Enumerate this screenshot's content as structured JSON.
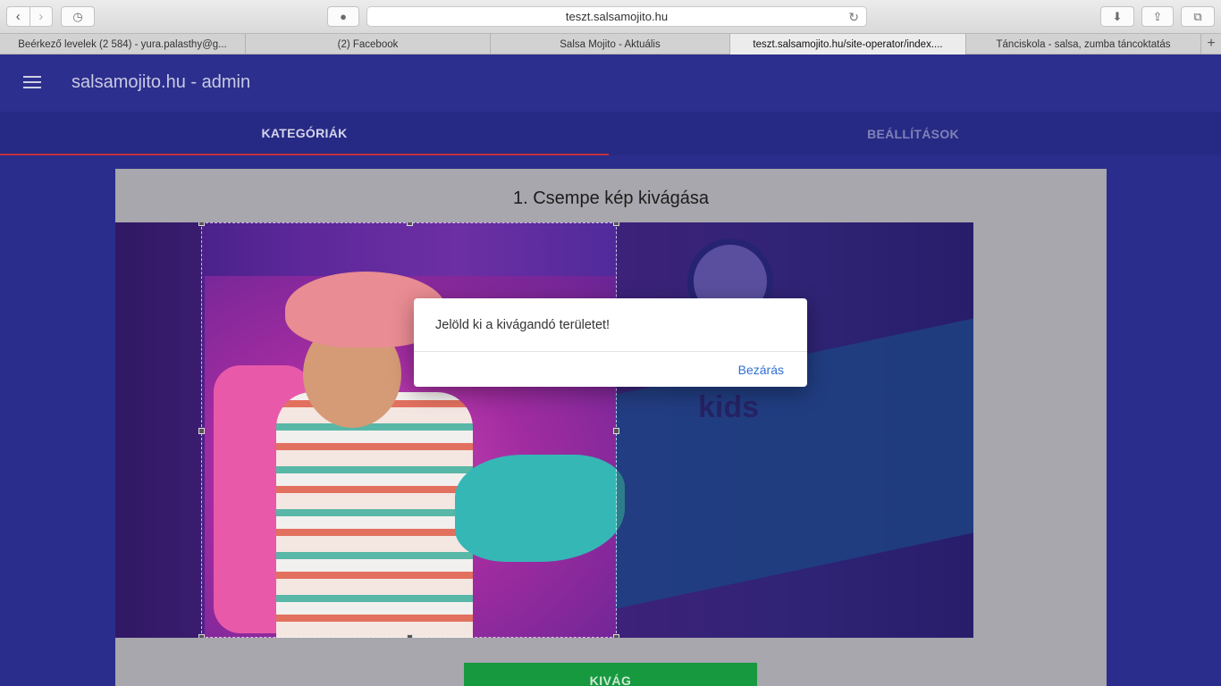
{
  "browser": {
    "url": "teszt.salsamojito.hu",
    "tabs": [
      "Beérkező levelek (2 584) - yura.palasthy@g...",
      "(2) Facebook",
      "Salsa Mojito - Aktuális",
      "teszt.salsamojito.hu/site-operator/index....",
      "Tánciskola - salsa, zumba táncoktatás"
    ],
    "new_tab": "+"
  },
  "app": {
    "title": "salsamojito.hu - admin",
    "nav_tabs": [
      "KATEGÓRIÁK",
      "BEÁLLÍTÁSOK"
    ],
    "card_title": "1. Csempe kép kivágása",
    "image_text": "kids",
    "crop_button": "KIVÁG"
  },
  "dialog": {
    "message": "Jelöld ki a kivágandó területet!",
    "close_label": "Bezárás"
  },
  "colors": {
    "accent_tab": "#c0303a",
    "primary": "#2c2f8d",
    "button": "#17993f",
    "link": "#2f6fd6"
  }
}
